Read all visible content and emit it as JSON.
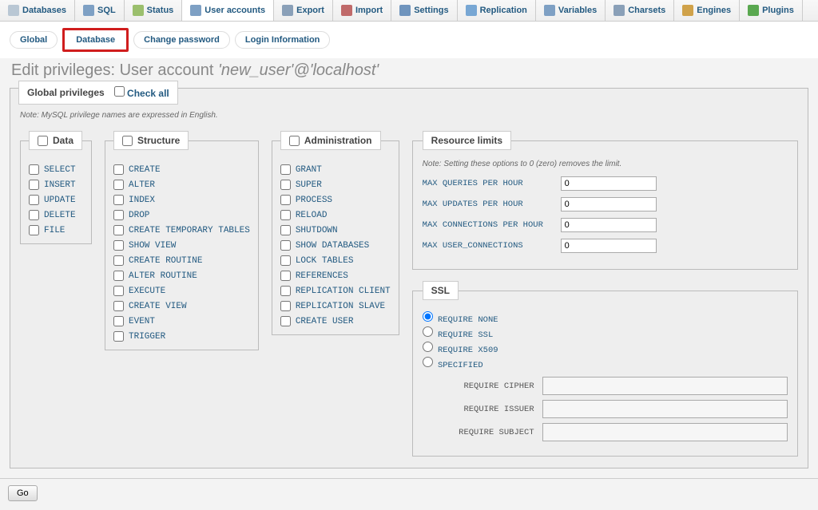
{
  "topnav": [
    {
      "label": "Databases",
      "active": false,
      "icon": "db-icon",
      "color": "#b9c7d4"
    },
    {
      "label": "SQL",
      "active": false,
      "icon": "sql-icon",
      "color": "#7ea0c4"
    },
    {
      "label": "Status",
      "active": false,
      "icon": "status-icon",
      "color": "#9bbf6d"
    },
    {
      "label": "User accounts",
      "active": true,
      "icon": "user-icon",
      "color": "#7ea0c4"
    },
    {
      "label": "Export",
      "active": false,
      "icon": "export-icon",
      "color": "#8aa0b8"
    },
    {
      "label": "Import",
      "active": false,
      "icon": "import-icon",
      "color": "#c06a6a"
    },
    {
      "label": "Settings",
      "active": false,
      "icon": "settings-icon",
      "color": "#6f94bd"
    },
    {
      "label": "Replication",
      "active": false,
      "icon": "replication-icon",
      "color": "#78a7d4"
    },
    {
      "label": "Variables",
      "active": false,
      "icon": "variables-icon",
      "color": "#7ea0c4"
    },
    {
      "label": "Charsets",
      "active": false,
      "icon": "charsets-icon",
      "color": "#8aa0b8"
    },
    {
      "label": "Engines",
      "active": false,
      "icon": "engines-icon",
      "color": "#d0a24a"
    },
    {
      "label": "Plugins",
      "active": false,
      "icon": "plugins-icon",
      "color": "#5aa850"
    }
  ],
  "subtabs": {
    "global": "Global",
    "database": "Database",
    "change_pw": "Change password",
    "login_info": "Login Information"
  },
  "title_prefix": "Edit privileges: User account ",
  "title_account": "'new_user'@'localhost'",
  "global_privileges_label": "Global privileges",
  "check_all": "Check all",
  "note": "Note: MySQL privilege names are expressed in English.",
  "groups": {
    "data": {
      "title": "Data",
      "items": [
        "SELECT",
        "INSERT",
        "UPDATE",
        "DELETE",
        "FILE"
      ]
    },
    "structure": {
      "title": "Structure",
      "items": [
        "CREATE",
        "ALTER",
        "INDEX",
        "DROP",
        "CREATE TEMPORARY TABLES",
        "SHOW VIEW",
        "CREATE ROUTINE",
        "ALTER ROUTINE",
        "EXECUTE",
        "CREATE VIEW",
        "EVENT",
        "TRIGGER"
      ]
    },
    "admin": {
      "title": "Administration",
      "items": [
        "GRANT",
        "SUPER",
        "PROCESS",
        "RELOAD",
        "SHUTDOWN",
        "SHOW DATABASES",
        "LOCK TABLES",
        "REFERENCES",
        "REPLICATION CLIENT",
        "REPLICATION SLAVE",
        "CREATE USER"
      ]
    }
  },
  "resource": {
    "title": "Resource limits",
    "note": "Note: Setting these options to 0 (zero) removes the limit.",
    "rows": [
      {
        "label": "MAX QUERIES PER HOUR",
        "value": "0"
      },
      {
        "label": "MAX UPDATES PER HOUR",
        "value": "0"
      },
      {
        "label": "MAX CONNECTIONS PER HOUR",
        "value": "0"
      },
      {
        "label": "MAX USER_CONNECTIONS",
        "value": "0"
      }
    ]
  },
  "ssl": {
    "title": "SSL",
    "options": [
      "REQUIRE NONE",
      "REQUIRE SSL",
      "REQUIRE X509",
      "SPECIFIED"
    ],
    "fields": [
      {
        "label": "REQUIRE CIPHER",
        "value": ""
      },
      {
        "label": "REQUIRE ISSUER",
        "value": ""
      },
      {
        "label": "REQUIRE SUBJECT",
        "value": ""
      }
    ]
  },
  "go": "Go"
}
